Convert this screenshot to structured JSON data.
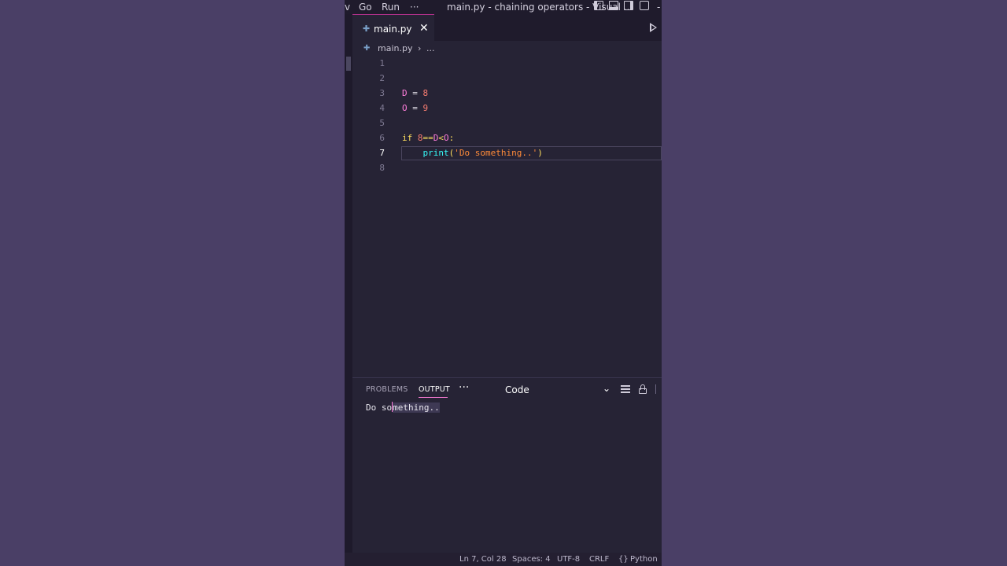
{
  "titlebar": {
    "menu_partial": "v",
    "menu_go": "Go",
    "menu_run": "Run",
    "menu_more": "···",
    "title": "main.py - chaining operators - Visual ...",
    "edge": "-"
  },
  "tab": {
    "label": "main.py",
    "close": "✕",
    "file_glyph": "✚"
  },
  "breadcrumb": {
    "file": "main.py",
    "sep": "›",
    "more": "..."
  },
  "editor": {
    "line_numbers": [
      "1",
      "2",
      "3",
      "4",
      "5",
      "6",
      "7",
      "8"
    ],
    "active_line": "7",
    "tokens": {
      "l3_var": "D",
      "l3_eq": " = ",
      "l3_num": "8",
      "l4_var": "O",
      "l4_eq": " = ",
      "l4_num": "9",
      "l6_kw": "if ",
      "l6_num": "8",
      "l6_op1": "==",
      "l6_var1": "D",
      "l6_op2": "<",
      "l6_var2": "O",
      "l6_colon": ":",
      "l7_indent": "    ",
      "l7_fn": "print",
      "l7_open": "(",
      "l7_str": "'Do something..'",
      "l7_close": ")"
    }
  },
  "panel": {
    "tabs": [
      "PROBLEMS",
      "OUTPUT"
    ],
    "more": "···",
    "select_value": "Code",
    "chevron": "⌄",
    "output": {
      "before": "Do so",
      "selected": "mething.."
    }
  },
  "status": {
    "position": "Ln 7, Col 28",
    "spaces": "Spaces: 4",
    "encoding": "UTF-8",
    "eol": "CRLF",
    "language_glyph": "{}",
    "language": "Python"
  },
  "colors": {
    "background": "#4a3f66",
    "editor_bg": "#262335",
    "accent": "#ff7edb",
    "keyword": "#fede5d",
    "number": "#f97e72",
    "function": "#36f9f6",
    "string": "#ff8b39"
  }
}
